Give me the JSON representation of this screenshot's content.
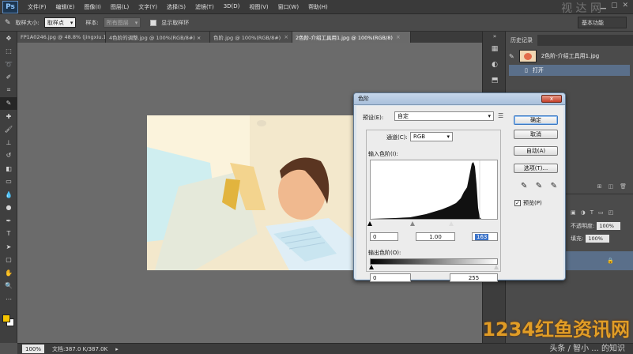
{
  "app": {
    "logo": "Ps",
    "menus": [
      "文件(F)",
      "编辑(E)",
      "图像(I)",
      "图层(L)",
      "文字(Y)",
      "选择(S)",
      "滤镜(T)",
      "3D(D)",
      "视图(V)",
      "窗口(W)",
      "帮助(H)"
    ],
    "watermark_top": "视 达 网",
    "workspace": "基本功能"
  },
  "options": {
    "sample_size_label": "取样大小:",
    "sample_size_value": "取样点",
    "sample_label": "样本:",
    "sample_value": "所有图层",
    "show_ring_label": "显示取样环"
  },
  "doc_tabs": [
    {
      "label": "FP1A0246.jpg @ 48.8% (jingxiu.1 (4), RGB/8...",
      "close": "×"
    },
    {
      "label": "4色阶的调整.jpg @ 100%(RGB/8#) ×",
      "close": "×"
    },
    {
      "label": "色阶.jpg @ 100%(RGB/8#)",
      "close": "×"
    },
    {
      "label": "2色阶-介绍工具用1.jpg @ 100%(RGB/8)",
      "close": "×"
    }
  ],
  "status": {
    "zoom": "100%",
    "doc_info": "文档:387.0 K/387.0K",
    "watermark": "1234红鱼资讯网",
    "watermark_sub": "头条 / 智小 ... 的知识"
  },
  "history": {
    "tab_label": "历史记录",
    "snapshot_label": "2色阶-介绍工具用1.jpg",
    "state_label": "打开"
  },
  "layers": {
    "opacity_label": "不透明度:",
    "opacity_value": "100%",
    "fill_label": "填充:",
    "fill_value": "100%",
    "lock_icon": "🔒"
  },
  "levels_dialog": {
    "title": "色阶",
    "close": "x",
    "preset_label": "预设(E):",
    "preset_value": "自定",
    "channel_label": "通道(C):",
    "channel_value": "RGB",
    "input_label": "输入色阶(I):",
    "input_black": "0",
    "input_gamma": "1.00",
    "input_white": "163",
    "output_label": "输出色阶(O):",
    "output_black": "0",
    "output_white": "255",
    "btn_ok": "确定",
    "btn_cancel": "取消",
    "btn_auto": "自动(A)",
    "btn_options": "选项(T)...",
    "preview_label": "预览(P)",
    "preview_checked": "✓"
  },
  "colors": {
    "foreground": "#f5c400",
    "background": "#ffffff"
  }
}
